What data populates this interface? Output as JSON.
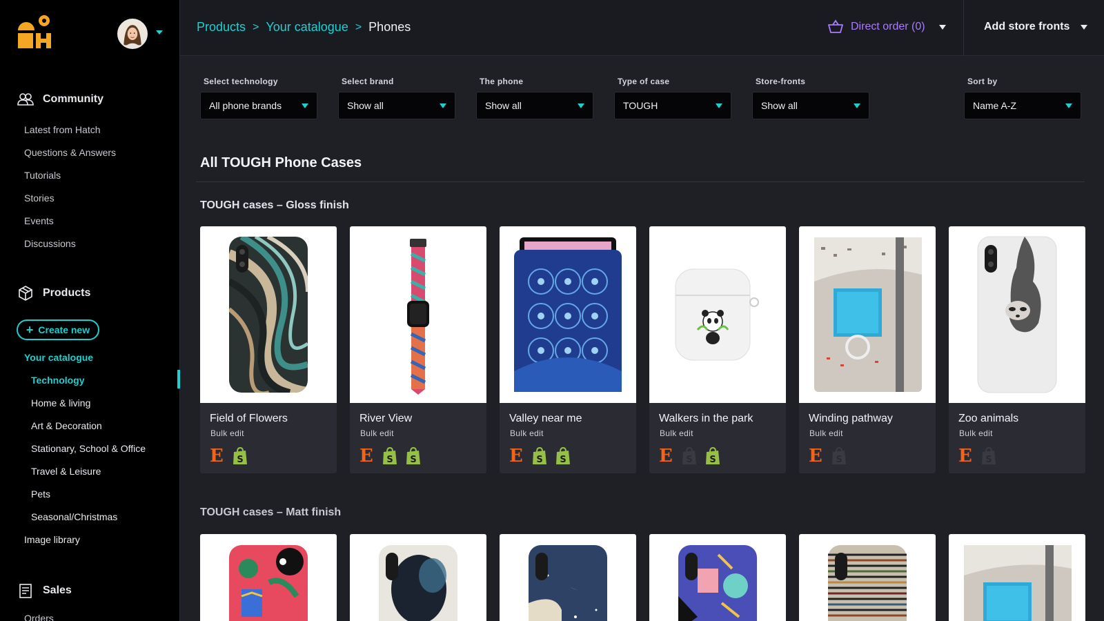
{
  "colors": {
    "accent": "#1fd0d0",
    "purple": "#a97cff",
    "etsy": "#f1641e",
    "shopify": "#95bf47",
    "logo": "#f5a623"
  },
  "sidebar": {
    "community": {
      "label": "Community",
      "icon": "community-icon",
      "items": [
        "Latest from Hatch",
        "Questions & Answers",
        "Tutorials",
        "Stories",
        "Events",
        "Discussions"
      ]
    },
    "products": {
      "label": "Products",
      "icon": "box-icon",
      "create_label": "Create new",
      "catalogue_label": "Your catalogue",
      "categories": [
        "Technology",
        "Home & living",
        "Art & Decoration",
        "Stationary, School & Office",
        "Travel & Leisure",
        "Pets",
        "Seasonal/Christmas"
      ],
      "image_library": "Image library"
    },
    "sales": {
      "label": "Sales",
      "icon": "receipt-icon",
      "items": [
        "Orders"
      ]
    }
  },
  "header": {
    "breadcrumbs": [
      "Products",
      "Your catalogue",
      "Phones"
    ],
    "direct_order": "Direct order (0)",
    "add_store_fronts": "Add store fronts"
  },
  "filters": [
    {
      "label": "Select technology",
      "value": "All phone brands"
    },
    {
      "label": "Select brand",
      "value": "Show all"
    },
    {
      "label": "The phone",
      "value": "Show all"
    },
    {
      "label": "Type of case",
      "value": "TOUGH"
    },
    {
      "label": "Store-fronts",
      "value": "Show all"
    },
    {
      "label": "Sort by",
      "value": "Name A-Z"
    }
  ],
  "main": {
    "title": "All TOUGH Phone Cases",
    "groups": [
      {
        "title": "TOUGH cases – Gloss finish",
        "products": [
          {
            "name": "Field of Flowers",
            "sub": "Bulk edit",
            "etsy": true,
            "shopify": [
              true
            ],
            "image": "agate-phone-case"
          },
          {
            "name": "River View",
            "sub": "Bulk edit",
            "etsy": true,
            "shopify": [
              true,
              true
            ],
            "image": "watch-strap"
          },
          {
            "name": "Valley near me",
            "sub": "Bulk edit",
            "etsy": true,
            "shopify": [
              true,
              true
            ],
            "image": "mosaic-tablet-sleeve"
          },
          {
            "name": "Walkers in the park",
            "sub": "Bulk edit",
            "etsy": true,
            "shopify": [
              false,
              true
            ],
            "image": "panda-airpods-case"
          },
          {
            "name": "Winding pathway",
            "sub": "Bulk edit",
            "etsy": true,
            "shopify": [
              false
            ],
            "image": "pool-notebook"
          },
          {
            "name": "Zoo animals",
            "sub": "Bulk edit",
            "etsy": true,
            "shopify": [
              false
            ],
            "image": "sloth-phone-case"
          }
        ]
      },
      {
        "title": "TOUGH cases – Matt finish",
        "products": [
          {
            "image": "floral-phone-case"
          },
          {
            "image": "abstract-blur-phone-case"
          },
          {
            "image": "night-sky-phone-case"
          },
          {
            "image": "memphis-pattern-phone-case"
          },
          {
            "image": "stripes-phone-case"
          },
          {
            "image": "pool-notebook"
          }
        ]
      }
    ]
  }
}
